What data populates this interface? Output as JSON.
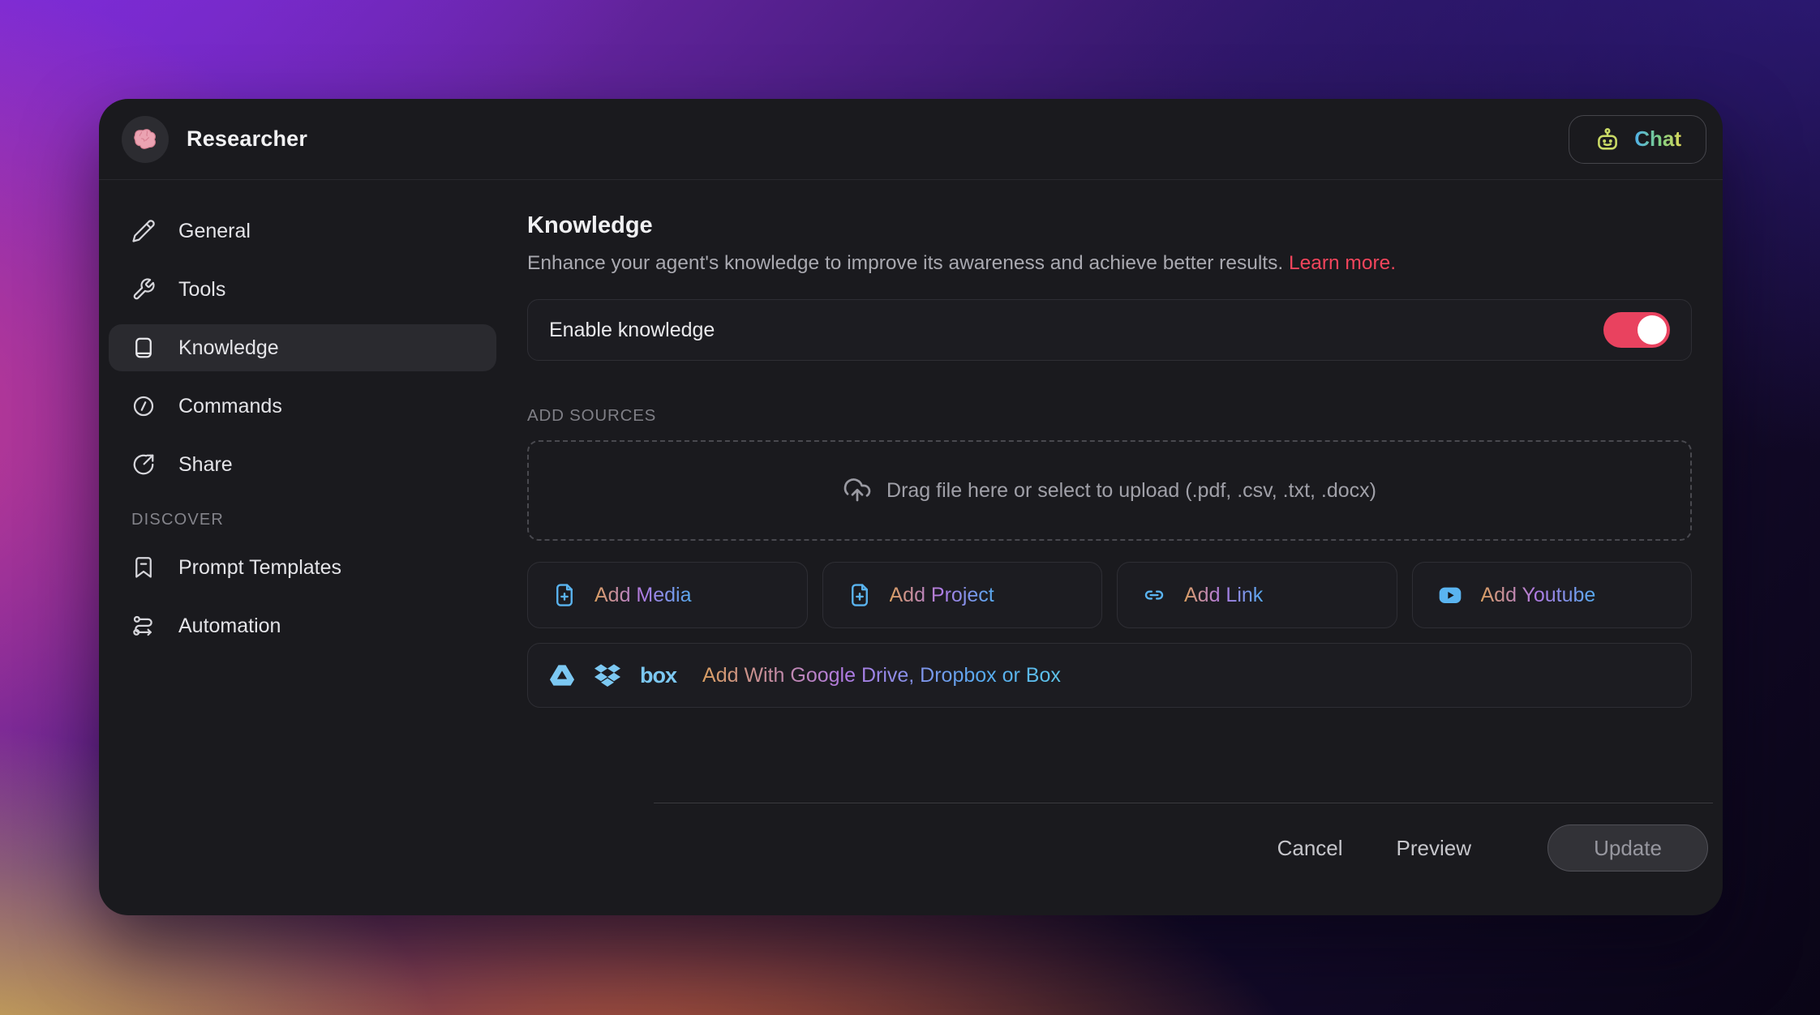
{
  "window": {
    "title": "Researcher",
    "chat_label": "Chat"
  },
  "sidebar": {
    "items": [
      {
        "label": "General",
        "icon": "pencil",
        "selected": false
      },
      {
        "label": "Tools",
        "icon": "wrench",
        "selected": false
      },
      {
        "label": "Knowledge",
        "icon": "book",
        "selected": true
      },
      {
        "label": "Commands",
        "icon": "slash",
        "selected": false
      },
      {
        "label": "Share",
        "icon": "share",
        "selected": false
      }
    ],
    "discover": {
      "heading": "DISCOVER",
      "items": [
        {
          "label": "Prompt Templates",
          "icon": "bookmark"
        },
        {
          "label": "Automation",
          "icon": "route"
        }
      ]
    }
  },
  "main": {
    "title": "Knowledge",
    "description": "Enhance your agent's knowledge to improve its awareness and achieve better results.",
    "learn_more": "Learn more.",
    "enable_row": {
      "label": "Enable knowledge",
      "enabled": true
    },
    "add_sources_heading": "ADD SOURCES",
    "dropzone_text": "Drag file here or select to upload (.pdf, .csv, .txt, .docx)",
    "source_buttons": [
      {
        "label": "Add Media",
        "icon": "file-plus"
      },
      {
        "label": "Add Project",
        "icon": "file-plus"
      },
      {
        "label": "Add Link",
        "icon": "link"
      },
      {
        "label": "Add Youtube",
        "icon": "youtube"
      }
    ],
    "cloud_row": {
      "label": "Add With Google Drive, Dropbox or Box",
      "box_logo_text": "box"
    }
  },
  "footer": {
    "cancel_label": "Cancel",
    "preview_label": "Preview",
    "update_label": "Update"
  },
  "colors": {
    "accent_toggle": "#e9425f",
    "learn_more_red": "#f2455c",
    "icon_blue": "#5ab4f0",
    "cloud_icon_blue": "#7cc8f2",
    "grad_text": [
      "#d99e62",
      "#b07ae2",
      "#57aaf0"
    ],
    "chat_grad": [
      "#4fb0ea",
      "#7ecf84",
      "#ded95a"
    ],
    "panel_bg": "#1a1a1e"
  }
}
